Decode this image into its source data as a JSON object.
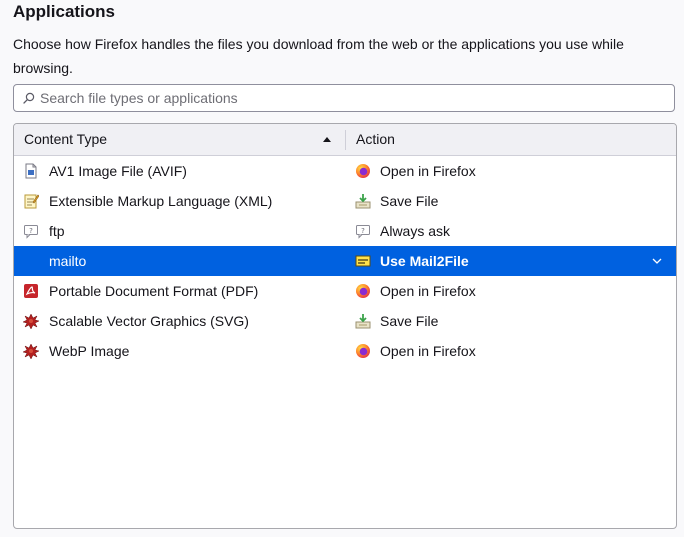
{
  "section": {
    "title": "Applications",
    "description": "Choose how Firefox handles the files you download from the web or the applications you use while browsing."
  },
  "search": {
    "placeholder": "Search file types or applications",
    "icon": "search-icon"
  },
  "table": {
    "columns": {
      "content_type": "Content Type",
      "action": "Action"
    },
    "rows": [
      {
        "type": "AV1 Image File (AVIF)",
        "type_icon": "image-file-icon",
        "action": "Open in Firefox",
        "action_icon": "firefox-icon"
      },
      {
        "type": "Extensible Markup Language (XML)",
        "type_icon": "xml-document-icon",
        "action": "Save File",
        "action_icon": "save-file-icon"
      },
      {
        "type": "ftp",
        "type_icon": "ask-icon",
        "action": "Always ask",
        "action_icon": "ask-icon"
      },
      {
        "type": "mailto",
        "type_icon": "",
        "action": "Use Mail2File",
        "action_icon": "mail-app-icon",
        "selected": true
      },
      {
        "type": "Portable Document Format (PDF)",
        "type_icon": "pdf-icon",
        "action": "Open in Firefox",
        "action_icon": "firefox-icon"
      },
      {
        "type": "Scalable Vector Graphics (SVG)",
        "type_icon": "svg-file-icon",
        "action": "Save File",
        "action_icon": "save-file-icon"
      },
      {
        "type": "WebP Image",
        "type_icon": "svg-file-icon",
        "action": "Open in Firefox",
        "action_icon": "firefox-icon"
      }
    ]
  },
  "colors": {
    "selection": "#0061e0",
    "header_bg": "#f0f0f4",
    "page_bg": "#f9f9fb"
  }
}
